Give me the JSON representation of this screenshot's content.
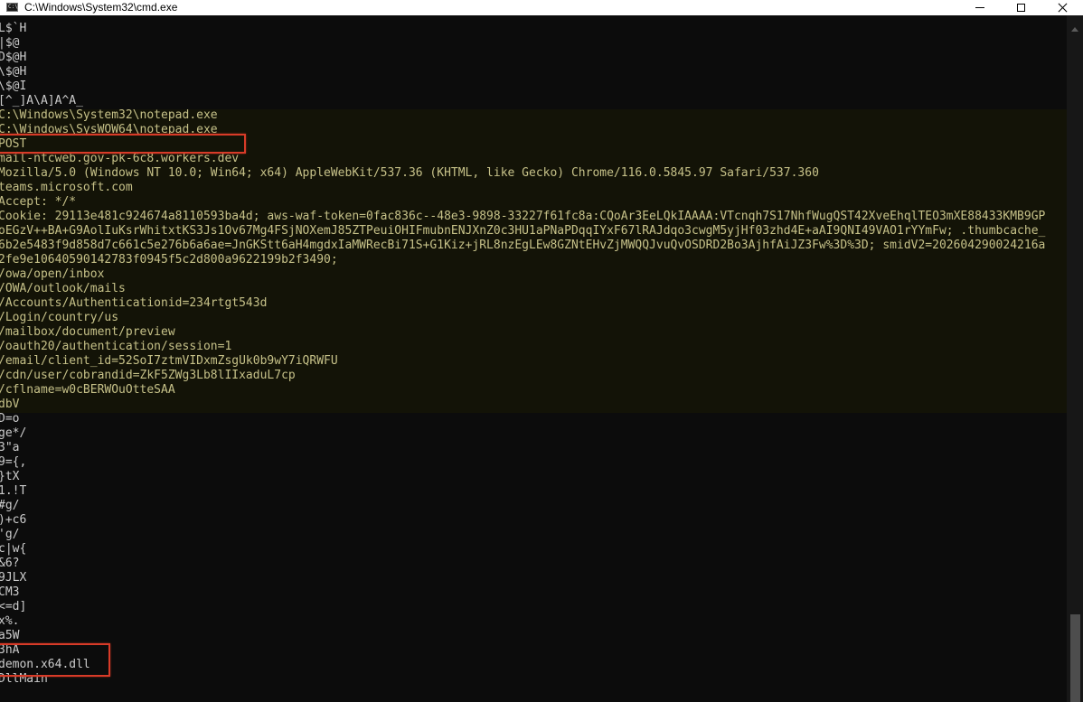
{
  "window": {
    "title": "C:\\Windows\\System32\\cmd.exe",
    "icon": "cmd-icon",
    "icon_glyph": "C:\\",
    "controls": [
      "minimize-icon",
      "maximize-icon",
      "close-icon"
    ]
  },
  "console": {
    "lines": [
      "L$`H",
      "|$@",
      "D$@H",
      "\\$@H",
      "\\$@I",
      "[^_]A\\A]A^A_",
      "C:\\Windows\\System32\\notepad.exe",
      "C:\\Windows\\SysWOW64\\notepad.exe",
      "POST",
      "mail-ntcweb.gov-pk-6c8.workers.dev",
      "Mozilla/5.0 (Windows NT 10.0; Win64; x64) AppleWebKit/537.36 (KHTML, like Gecko) Chrome/116.0.5845.97 Safari/537.360",
      "teams.microsoft.com",
      "Accept: */*",
      "Cookie: 29113e481c924674a8110593ba4d; aws-waf-token=0fac836c--48e3-9898-33227f61fc8a:CQoAr3EeLQkIAAAA:VTcnqh7S17NhfWugQST42XveEhqlTEO3mXE88433KMB9GP",
      "oEGzV++BA+G9AolIuKsrWhitxtKS3Js1Ov67Mg4FSjNOXemJ85ZTPeuiOHIFmubnENJXnZ0c3HU1aPNaPDqqIYxF67lRAJdqo3cwgM5yjHf03zhd4E+aAI9QNI49VAO1rYYmFw; .thumbcache_",
      "6b2e5483f9d858d7c661c5e276b6a6ae=JnGKStt6aH4mgdxIaMWRecBi71S+G1Kiz+jRL8nzEgLEw8GZNtEHvZjMWQQJvuQvOSDRD2Bo3AjhfAiJZ3Fw%3D%3D; smidV2=202604290024216a",
      "2fe9e10640590142783f0945f5c2d800a9622199b2f3490;",
      "/owa/open/inbox",
      "/OWA/outlook/mails",
      "/Accounts/Authenticationid=234rtgt543d",
      "/Login/country/us",
      "/mailbox/document/preview",
      "/oauth20/authentication/session=1",
      "/email/client_id=52SoI7ztmVIDxmZsgUk0b9wY7iQRWFU",
      "/cdn/user/cobrandid=ZkF5ZWg3Lb8lIIxaduL7cp",
      "/cflname=w0cBERWOuOtteSAA",
      "dbV",
      "D=o",
      "ge*/",
      "3\"a",
      "9={,",
      "}tX",
      "1.!T",
      "#g/",
      ")+c6",
      "'g/",
      "c|w{",
      "&6?",
      "9JLX",
      "CM3",
      "<=d]",
      "x%.",
      "a5W",
      "3hA",
      "demon.x64.dll",
      "DllMain"
    ]
  },
  "colors": {
    "console_background": "#0c0c0c",
    "console_text": "#cccccc",
    "highlight_band_background": "#131307",
    "highlight_band_text": "#c6c188",
    "annotation_box": "#d83b28"
  },
  "scrollbar": {
    "icon": "scroll-up-arrow-icon",
    "position_fraction": 0.87
  }
}
